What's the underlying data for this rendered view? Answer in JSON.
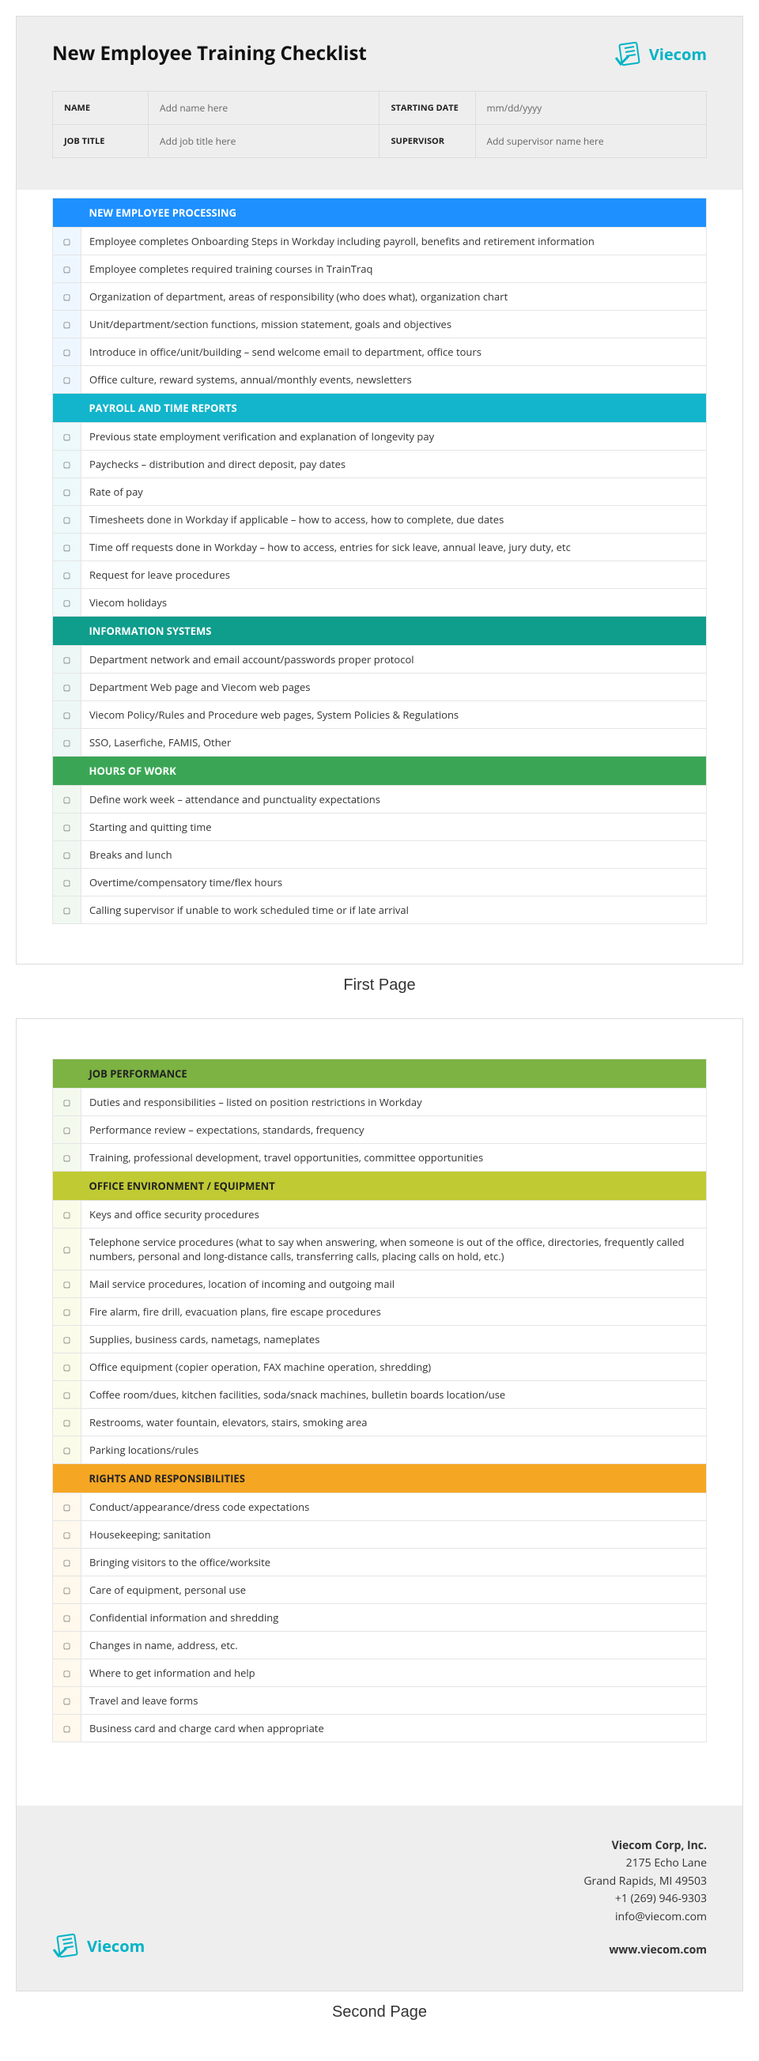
{
  "document": {
    "title": "New Employee Training Checklist",
    "brand": "Viecom"
  },
  "info": {
    "name_label": "NAME",
    "name_value": "Add name here",
    "date_label": "STARTING DATE",
    "date_value": "mm/dd/yyyy",
    "title_label": "JOB TITLE",
    "title_value": "Add job title here",
    "supervisor_label": "SUPERVISOR",
    "supervisor_value": "Add supervisor name here"
  },
  "checkbox_glyph": "▢",
  "sections_page1": [
    {
      "title": "NEW EMPLOYEE PROCESSING",
      "hbg": "#1e90ff",
      "hfg": "#fff",
      "tint": "#eef7ff",
      "items": [
        "Employee completes Onboarding Steps in Workday including payroll, benefits and retirement information",
        "Employee completes required training courses in TrainTraq",
        "Organization of department, areas of responsibility (who does what), organization chart",
        "Unit/department/section functions, mission statement, goals and objectives",
        "Introduce in office/unit/building – send welcome email to department, office tours",
        "Office culture, reward systems, annual/monthly events, newsletters"
      ]
    },
    {
      "title": "PAYROLL AND TIME REPORTS",
      "hbg": "#13b5cc",
      "hfg": "#fff",
      "tint": "#edf9fb",
      "items": [
        "Previous state employment verification and explanation of longevity pay",
        "Paychecks – distribution and direct deposit, pay dates",
        "Rate of pay",
        "Timesheets done in Workday if applicable – how to access, how to complete, due dates",
        "Time off requests done in Workday – how to access, entries for sick leave, annual leave, jury duty, etc",
        "Request for leave procedures",
        "Viecom holidays"
      ]
    },
    {
      "title": "INFORMATION SYSTEMS",
      "hbg": "#0f9d8c",
      "hfg": "#fff",
      "tint": "#edf7f5",
      "items": [
        "Department network and email account/passwords proper protocol",
        "Department Web page and Viecom web pages",
        "Viecom Policy/Rules and Procedure web pages, System Policies & Regulations",
        "SSO, Laserfiche, FAMIS, Other"
      ]
    },
    {
      "title": "HOURS OF WORK",
      "hbg": "#3aa655",
      "hfg": "#fff",
      "tint": "#f0f8f1",
      "items": [
        "Define work week – attendance and punctuality expectations",
        "Starting and quitting time",
        "Breaks and lunch",
        "Overtime/compensatory time/flex hours",
        "Calling supervisor if unable to work scheduled time or if late arrival"
      ]
    }
  ],
  "sections_page2": [
    {
      "title": "JOB PERFORMANCE",
      "hbg": "#7cb342",
      "hfg": "#222",
      "tint": "#f4f9ee",
      "items": [
        "Duties and responsibilities – listed on position restrictions in Workday",
        "Performance review – expectations, standards, frequency",
        "Training, professional development, travel opportunities, committee opportunities"
      ]
    },
    {
      "title": "OFFICE ENVIRONMENT / EQUIPMENT",
      "hbg": "#c0ca33",
      "hfg": "#222",
      "tint": "#fafbe9",
      "items": [
        "Keys and office security procedures",
        "Telephone service procedures (what to say when answering, when someone is out of the office, directories, frequently called numbers, personal and long-distance calls, transferring calls, placing calls on hold, etc.)",
        "Mail service procedures, location of incoming and outgoing mail",
        "Fire alarm, fire drill, evacuation plans, fire escape procedures",
        "Supplies, business cards, nametags, nameplates",
        "Office equipment (copier operation, FAX machine operation, shredding)",
        "Coffee room/dues, kitchen facilities, soda/snack machines, bulletin boards location/use",
        "Restrooms, water fountain, elevators, stairs, smoking area",
        "Parking locations/rules"
      ]
    },
    {
      "title": "RIGHTS AND RESPONSIBILITIES",
      "hbg": "#f5a623",
      "hfg": "#222",
      "tint": "#fef8ed",
      "items": [
        "Conduct/appearance/dress code expectations",
        "Housekeeping; sanitation",
        "Bringing visitors to the office/worksite",
        "Care of equipment, personal use",
        "Confidential information and shredding",
        "Changes in name, address, etc.",
        "Where to get information and help",
        "Travel and leave forms",
        "Business card and charge card when appropriate"
      ]
    }
  ],
  "footer": {
    "company": "Viecom Corp, Inc.",
    "address1": "2175  Echo Lane",
    "address2": "Grand Rapids, MI 49503",
    "phone": "+1 (269) 946-9303",
    "email": "info@viecom.com",
    "web": "www.viecom.com"
  },
  "labels": {
    "page1": "First Page",
    "page2": "Second Page"
  }
}
